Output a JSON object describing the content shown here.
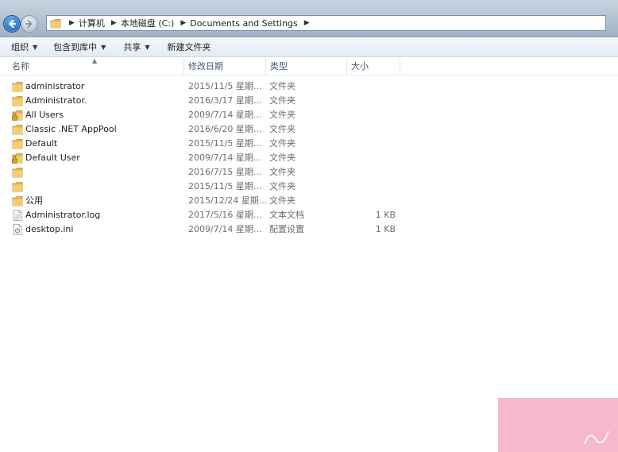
{
  "address": {
    "crumbs": [
      "计算机",
      "本地磁盘 (C:)",
      "Documents and Settings"
    ]
  },
  "toolbar": {
    "organize": "组织",
    "include_in_library": "包含到库中",
    "share": "共享",
    "new_folder": "新建文件夹"
  },
  "columns": {
    "name": "名称",
    "modified": "修改日期",
    "type": "类型",
    "size": "大小"
  },
  "files": [
    {
      "name": "administrator",
      "modified": "2015/11/5 星期...",
      "type": "文件夹",
      "size": "",
      "icon": "folder-icon"
    },
    {
      "name": "Administrator.",
      "modified": "2016/3/17 星期...",
      "type": "文件夹",
      "size": "",
      "icon": "folder-icon"
    },
    {
      "name": "All Users",
      "modified": "2009/7/14 星期...",
      "type": "文件夹",
      "size": "",
      "icon": "locked-folder-icon"
    },
    {
      "name": "Classic .NET AppPool",
      "modified": "2016/6/20 星期...",
      "type": "文件夹",
      "size": "",
      "icon": "folder-icon"
    },
    {
      "name": "Default",
      "modified": "2015/11/5 星期...",
      "type": "文件夹",
      "size": "",
      "icon": "folder-icon"
    },
    {
      "name": "Default User",
      "modified": "2009/7/14 星期...",
      "type": "文件夹",
      "size": "",
      "icon": "locked-folder-icon"
    },
    {
      "name": "",
      "modified": "2016/7/15 星期...",
      "type": "文件夹",
      "size": "",
      "icon": "folder-icon"
    },
    {
      "name": "",
      "modified": "2015/11/5 星期...",
      "type": "文件夹",
      "size": "",
      "icon": "folder-icon"
    },
    {
      "name": "公用",
      "modified": "2015/12/24 星期...",
      "type": "文件夹",
      "size": "",
      "icon": "folder-icon"
    },
    {
      "name": "Administrator.log",
      "modified": "2017/5/16 星期...",
      "type": "文本文档",
      "size": "1 KB",
      "icon": "text-document-icon"
    },
    {
      "name": "desktop.ini",
      "modified": "2009/7/14 星期...",
      "type": "配置设置",
      "size": "1 KB",
      "icon": "settings-file-icon"
    }
  ],
  "colors": {
    "folder": "#e8b64a",
    "corner_block": "#f6b8cf"
  }
}
